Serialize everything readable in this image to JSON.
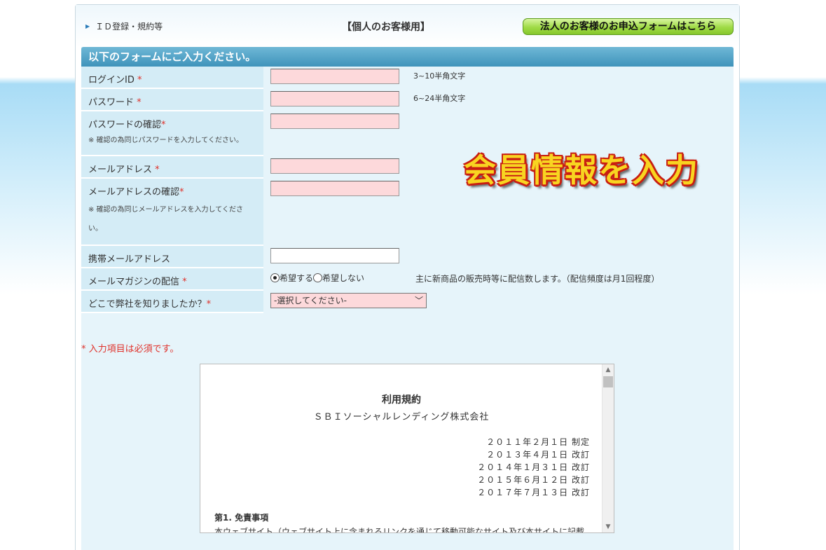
{
  "header": {
    "breadcrumb": "ＩＤ登録・規約等",
    "page_title": "【個人のお客様用】",
    "corporate_button": "法人のお客様のお申込フォームはこちら"
  },
  "form": {
    "section_title": "以下のフォームにご入力ください。",
    "required_mark": "*",
    "login_id": {
      "label": "ログインID",
      "hint": "3~10半角文字"
    },
    "password": {
      "label": "パスワード",
      "hint": "6~24半角文字"
    },
    "password_confirm": {
      "label": "パスワードの確認",
      "note": "※ 確認の為同じパスワードを入力してください。"
    },
    "email": {
      "label": "メールアドレス"
    },
    "email_confirm": {
      "label": "メールアドレスの確認",
      "note_line1": "※ 確認の為同じメールアドレスを入力してくださ",
      "note_line2": "い。"
    },
    "mobile_email": {
      "label": "携帯メールアドレス"
    },
    "newsletter": {
      "label": "メールマガジンの配信",
      "option_yes": "希望する",
      "option_no": "希望しない",
      "selected": "希望する",
      "hint": "主に新商品の販売時等に配信数します。（配信頻度は月1回程度）"
    },
    "referral": {
      "label": "どこで弊社を知りましたか？",
      "selected": "-選択してください-"
    },
    "required_note": "* 入力項目は必須です。"
  },
  "banner": {
    "text": "会員情報を入力"
  },
  "terms": {
    "title": "利用規約",
    "company": "ＳＢＩソーシャルレンディング株式会社",
    "dates": [
      "２０１１年２月１日 制定",
      "２０１３年４月１日 改訂",
      "２０１４年１月３１日 改訂",
      "２０１５年６月１２日 改訂",
      "２０１７年７月１３日 改訂"
    ],
    "section1_title": "第1. 免責事項",
    "section1_body": "本ウェブサイト（ウェブサイト上に含まれるリンクを通じて移動可能なサイト及び本サイトに記載"
  },
  "colors": {
    "required": "#e0312a",
    "input_bg": "#fdd9db",
    "header_bar": "#3f93bb",
    "banner_fill": "#f8d521",
    "banner_outline": "#c81e12"
  }
}
